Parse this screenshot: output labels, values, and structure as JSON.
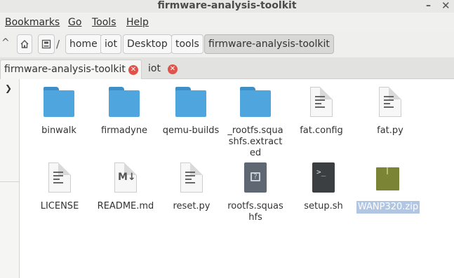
{
  "window": {
    "title": "firmware-analysis-toolkit",
    "minimize_glyph": "–",
    "close_glyph": "✕"
  },
  "menu": {
    "bookmarks": "Bookmarks",
    "go": "Go",
    "tools": "Tools",
    "help": "Help"
  },
  "nav": {
    "up_glyph": "^"
  },
  "breadcrumb": {
    "items": [
      "home",
      "iot",
      "Desktop",
      "tools",
      "firmware-analysis-toolkit"
    ],
    "separator": "/"
  },
  "tabs": [
    {
      "label": "firmware-analysis-toolkit",
      "active": true
    },
    {
      "label": "iot",
      "active": false
    }
  ],
  "sidebar": {
    "expand_glyph": "⌄"
  },
  "files": [
    {
      "name": "binwalk",
      "type": "folder"
    },
    {
      "name": "firmadyne",
      "type": "folder"
    },
    {
      "name": "qemu-builds",
      "type": "folder"
    },
    {
      "name": "_rootfs.squashfs.extracted",
      "type": "folder"
    },
    {
      "name": "fat.config",
      "type": "text"
    },
    {
      "name": "fat.py",
      "type": "text"
    },
    {
      "name": "LICENSE",
      "type": "text"
    },
    {
      "name": "README.md",
      "type": "markdown"
    },
    {
      "name": "reset.py",
      "type": "text"
    },
    {
      "name": "rootfs.squashfs",
      "type": "package"
    },
    {
      "name": "setup.sh",
      "type": "script"
    },
    {
      "name": "WANP320.zip",
      "type": "archive",
      "selected": true
    }
  ],
  "icons": {
    "folder": "folder-icon",
    "text": "text-file-icon",
    "markdown": "markdown-file-icon",
    "package": "package-file-icon",
    "script": "shell-script-icon",
    "archive": "zip-archive-icon"
  },
  "colors": {
    "folder": "#4fa6df",
    "selection": "#b1c6e2",
    "close": "#e0534a"
  }
}
